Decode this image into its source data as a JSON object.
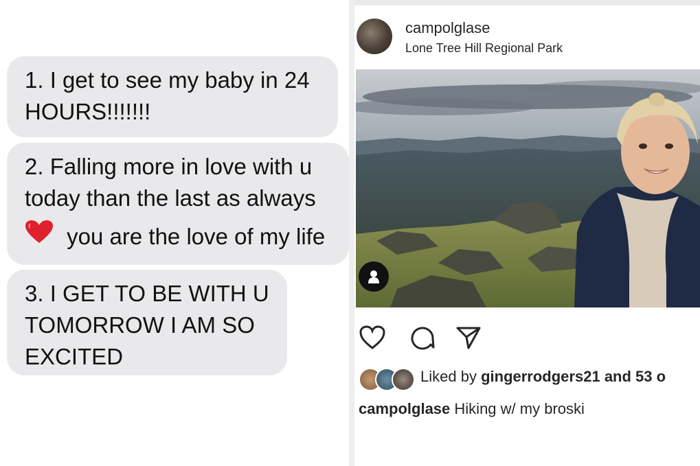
{
  "messages": {
    "bubble1": {
      "line1": "1. I get to see my baby in 24",
      "line2": "HOURS!!!!!!!"
    },
    "bubble2": {
      "line1": "2. Falling more in love with u",
      "line2": "today than the last as always",
      "line3": "you are the love of my life",
      "emoji": "heart-icon"
    },
    "bubble3": {
      "line1": "3. I GET TO BE WITH U",
      "line2": "TOMORROW I AM SO",
      "line3": "EXCITED"
    }
  },
  "post": {
    "username": "campolglase",
    "location": "Lone Tree Hill Regional Park",
    "icons": [
      "user-tag-icon",
      "heart-outline-icon",
      "comment-icon",
      "share-icon"
    ],
    "liked_prefix": "Liked by",
    "liked_user": "gingerrodgers21",
    "liked_suffix": "and 53 o",
    "caption_user": "campolglase",
    "caption_text": "Hiking w/ my broski"
  },
  "colors": {
    "bubble": "#e9e9eb",
    "text": "#111111",
    "heart": "#e0202c"
  }
}
